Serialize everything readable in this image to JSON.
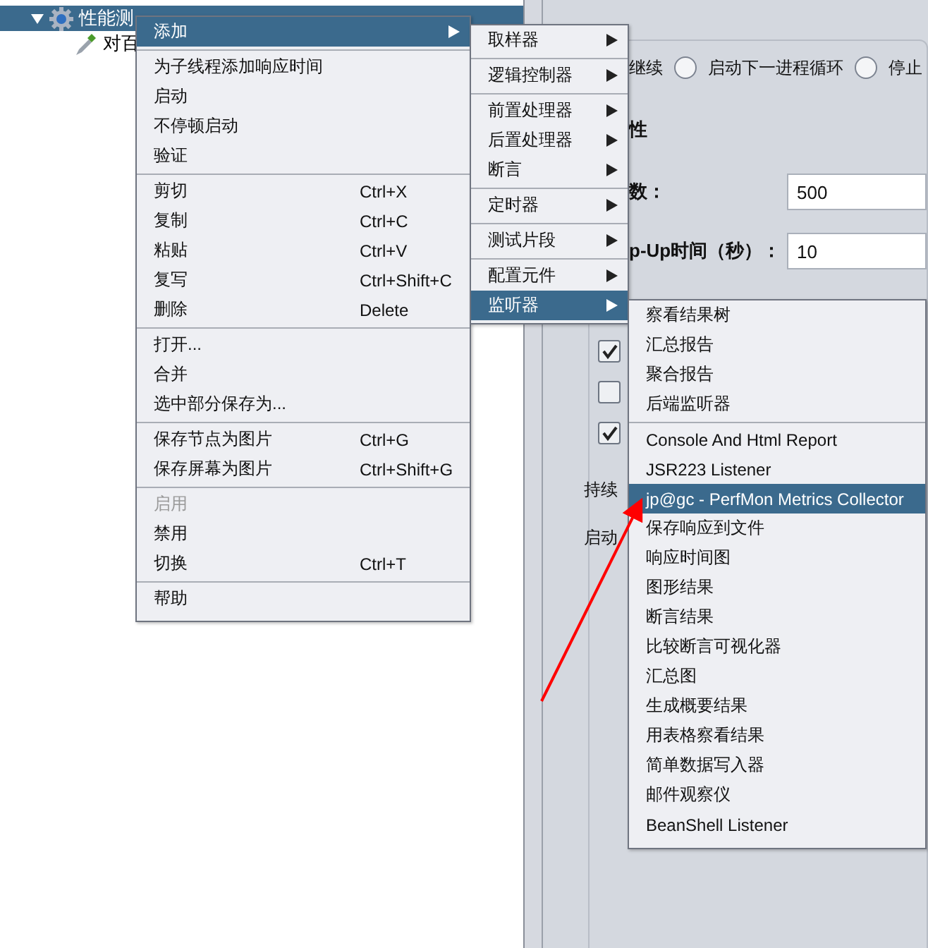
{
  "tree": {
    "items": [
      {
        "label": "性能测",
        "expanded": true,
        "selected": true,
        "children": [
          {
            "label": "对百",
            "selected": false
          }
        ]
      }
    ]
  },
  "thread_group": {
    "radios": [
      {
        "label": "继续",
        "kind": "text"
      },
      {
        "label": "启动下一进程循环",
        "selected": false,
        "kind": "radio"
      },
      {
        "label": "停止",
        "selected": false,
        "kind": "radio"
      }
    ],
    "section_title": "性",
    "fields": [
      {
        "label": "数：",
        "value": "500"
      },
      {
        "label": "p-Up时间（秒）：",
        "value": "10"
      }
    ],
    "checkboxes": [
      {
        "checked": true
      },
      {
        "checked": false
      },
      {
        "checked": true
      }
    ],
    "labels": [
      "持续",
      "启动"
    ]
  },
  "context_menu": {
    "groups": [
      [
        {
          "label": "添加",
          "submenu": true,
          "selected": true
        }
      ],
      [
        {
          "label": "为子线程添加响应时间",
          "selected": false,
          "disabled": false
        },
        {
          "label": "启动",
          "selected": false,
          "disabled": false
        },
        {
          "label": "不停顿启动",
          "selected": false,
          "disabled": false
        },
        {
          "label": "验证",
          "selected": false,
          "disabled": false
        }
      ],
      [
        {
          "label": "剪切",
          "shortcut": "Ctrl+X",
          "selected": false,
          "disabled": false
        },
        {
          "label": "复制",
          "shortcut": "Ctrl+C",
          "selected": false,
          "disabled": false
        },
        {
          "label": "粘贴",
          "shortcut": "Ctrl+V",
          "selected": false,
          "disabled": false
        },
        {
          "label": "复写",
          "shortcut": "Ctrl+Shift+C",
          "selected": false,
          "disabled": false
        },
        {
          "label": "删除",
          "shortcut": "Delete",
          "selected": false,
          "disabled": false
        }
      ],
      [
        {
          "label": "打开...",
          "selected": false,
          "disabled": false
        },
        {
          "label": "合并",
          "selected": false,
          "disabled": false
        },
        {
          "label": "选中部分保存为...",
          "selected": false,
          "disabled": false
        }
      ],
      [
        {
          "label": "保存节点为图片",
          "shortcut": "Ctrl+G",
          "selected": false,
          "disabled": false
        },
        {
          "label": "保存屏幕为图片",
          "shortcut": "Ctrl+Shift+G",
          "selected": false,
          "disabled": false
        }
      ],
      [
        {
          "label": "启用",
          "selected": false,
          "disabled": true
        },
        {
          "label": "禁用",
          "selected": false,
          "disabled": false
        },
        {
          "label": "切换",
          "shortcut": "Ctrl+T",
          "selected": false,
          "disabled": false
        }
      ],
      [
        {
          "label": "帮助",
          "selected": false,
          "disabled": false
        }
      ]
    ]
  },
  "add_submenu": {
    "groups": [
      [
        {
          "label": "取样器",
          "submenu": true,
          "selected": false
        }
      ],
      [
        {
          "label": "逻辑控制器",
          "submenu": true,
          "selected": false
        }
      ],
      [
        {
          "label": "前置处理器",
          "submenu": true,
          "selected": false
        },
        {
          "label": "后置处理器",
          "submenu": true,
          "selected": false
        },
        {
          "label": "断言",
          "submenu": true,
          "selected": false
        }
      ],
      [
        {
          "label": "定时器",
          "submenu": true,
          "selected": false
        }
      ],
      [
        {
          "label": "测试片段",
          "submenu": true,
          "selected": false
        }
      ],
      [
        {
          "label": "配置元件",
          "submenu": true,
          "selected": false
        },
        {
          "label": "监听器",
          "submenu": true,
          "selected": true
        }
      ]
    ]
  },
  "listener_submenu": {
    "groups": [
      [
        {
          "label": "察看结果树",
          "selected": false
        },
        {
          "label": "汇总报告",
          "selected": false
        },
        {
          "label": "聚合报告",
          "selected": false
        },
        {
          "label": "后端监听器",
          "selected": false
        }
      ],
      [
        {
          "label": "Console And Html Report",
          "selected": false
        },
        {
          "label": "JSR223 Listener",
          "selected": false
        },
        {
          "label": "jp@gc - PerfMon Metrics Collector",
          "selected": true
        },
        {
          "label": "保存响应到文件",
          "selected": false
        },
        {
          "label": "响应时间图",
          "selected": false
        },
        {
          "label": "图形结果",
          "selected": false
        },
        {
          "label": "断言结果",
          "selected": false
        },
        {
          "label": "比较断言可视化器",
          "selected": false
        },
        {
          "label": "汇总图",
          "selected": false
        },
        {
          "label": "生成概要结果",
          "selected": false
        },
        {
          "label": "用表格察看结果",
          "selected": false
        },
        {
          "label": "简单数据写入器",
          "selected": false
        },
        {
          "label": "邮件观察仪",
          "selected": false
        },
        {
          "label": "BeanShell Listener",
          "selected": false
        }
      ]
    ]
  }
}
